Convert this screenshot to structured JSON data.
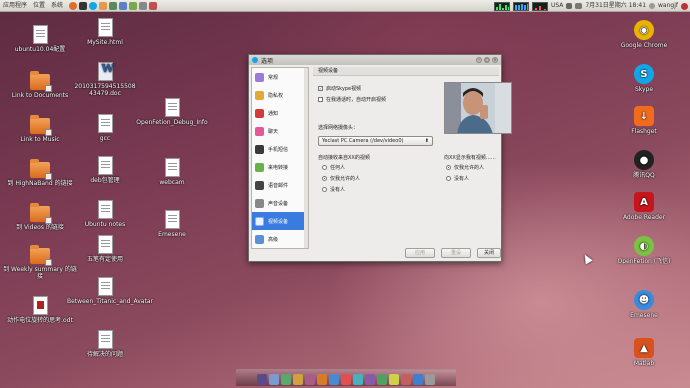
{
  "top_panel": {
    "menu_applications": "应用程序",
    "menu_places": "位置",
    "menu_system": "系统",
    "keyboard_layout": "USA",
    "clock": "7月31日星期六 18:41",
    "user": "wangjf",
    "icons": [
      "firefox-icon",
      "terminal-icon",
      "skype-icon",
      "folder-icon",
      "image-icon",
      "mail-icon",
      "chat-icon",
      "settings-icon",
      "music-icon"
    ]
  },
  "desktop_left": [
    {
      "name": "ubuntu-file",
      "label": "ubuntu10.04配置",
      "kind": "doc"
    },
    {
      "name": "link-to-documents",
      "label": "Link to Documents",
      "kind": "folder"
    },
    {
      "name": "link-to-music",
      "label": "Link to Music",
      "kind": "folder"
    },
    {
      "name": "highnaband-link",
      "label": "到 HighNaBand 的链接",
      "kind": "folder"
    },
    {
      "name": "videos-link",
      "label": "到 Videos 的链接",
      "kind": "folder"
    },
    {
      "name": "weekly-summary-link",
      "label": "到 Weekly summary 的链接",
      "kind": "folder"
    },
    {
      "name": "odt-file",
      "label": "动作电位旋转的思考.odt",
      "kind": "odt"
    }
  ],
  "desktop_col2": [
    {
      "name": "mysite-html",
      "label": "MySite.html",
      "kind": "doc"
    },
    {
      "name": "doc-file",
      "label": "2010317594515508 43479.doc",
      "kind": "word"
    },
    {
      "name": "gcc-file",
      "label": "gcc",
      "kind": "doc"
    },
    {
      "name": "deb-file",
      "label": "deb包管理",
      "kind": "doc"
    },
    {
      "name": "ubuntu-notes",
      "label": "Ubuntu notes",
      "kind": "doc"
    },
    {
      "name": "wubi-file",
      "label": "五笔有定使用",
      "kind": "doc"
    },
    {
      "name": "titanic-file",
      "label": "Between_Titanic_and_Avatar",
      "kind": "doc"
    },
    {
      "name": "pending-file",
      "label": "待解决的问题",
      "kind": "doc"
    }
  ],
  "desktop_col3": [
    {
      "name": "openfetion-debug",
      "label": "OpenFetion_Debug_Info",
      "kind": "doc"
    },
    {
      "name": "webcam-file",
      "label": "webcam",
      "kind": "doc"
    },
    {
      "name": "emesene-file",
      "label": "Emesene",
      "kind": "doc"
    }
  ],
  "desktop_right": [
    {
      "name": "google-chrome",
      "label": "Google Chrome",
      "color": "#e9b300"
    },
    {
      "name": "skype",
      "label": "Skype",
      "color": "#12a5e8"
    },
    {
      "name": "flashget",
      "label": "Flashget",
      "color": "#f26b1d"
    },
    {
      "name": "qq",
      "label": "腾讯QQ",
      "color": "#222222"
    },
    {
      "name": "adobe-reader",
      "label": "Adobe Reader",
      "color": "#c4161c"
    },
    {
      "name": "openfetion",
      "label": "OpenFetion (飞信)",
      "color": "#7bc142"
    },
    {
      "name": "emesene",
      "label": "Emesene",
      "color": "#3a8bdc"
    },
    {
      "name": "matlab",
      "label": "Matlab",
      "color": "#d9521d"
    }
  ],
  "dialog": {
    "title": "选项",
    "sidebar": [
      {
        "label": "常规",
        "color": "#9c7bd4"
      },
      {
        "label": "隐私权",
        "color": "#e0a93a"
      },
      {
        "label": "通知",
        "color": "#d23b3b"
      },
      {
        "label": "聊天",
        "color": "#e35a9a"
      },
      {
        "label": "手机短信",
        "color": "#3a3a3a"
      },
      {
        "label": "来电转接",
        "color": "#6ab04c"
      },
      {
        "label": "语音邮件",
        "color": "#444444"
      },
      {
        "label": "声音设备",
        "color": "#888888"
      },
      {
        "label": "视频设备",
        "color": "#4a88d8",
        "active": true
      },
      {
        "label": "高级",
        "color": "#5a8fd6"
      }
    ],
    "section_title": "视频设备",
    "enable_video": "启动Skype视频",
    "auto_start": "在我通话时，自动开启视频",
    "select_webcam_label": "选择网络摄像头：",
    "webcam_value": "Yeclast PC Camera (/dev/video0)",
    "receive_header": "自动接收来自XX的视频",
    "receive_options": [
      "任何人",
      "仅我允许的人",
      "没有人"
    ],
    "receive_selected": 1,
    "show_header": "向XX显示我有视频……",
    "show_options": [
      "仅我允许的人",
      "没有人"
    ],
    "show_selected": 0,
    "btn_apply": "应用",
    "btn_reset": "重设",
    "btn_close": "关闭"
  },
  "dock_colors": [
    "#5a4a8a",
    "#7b9bd0",
    "#5aa86a",
    "#d0a040",
    "#aa5b88",
    "#d77a2a",
    "#4a8ad0",
    "#e05050",
    "#4ab0c0",
    "#8a5aa8",
    "#50a060",
    "#d0d04a",
    "#c06060",
    "#3f7fd0",
    "#9a9a9a"
  ]
}
